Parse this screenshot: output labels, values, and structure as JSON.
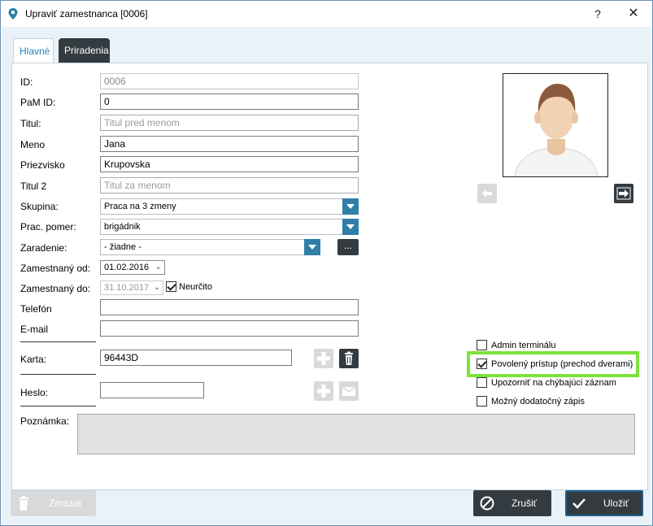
{
  "window": {
    "title": "Upraviť zamestnanca [0006]",
    "help_label": "?",
    "close_label": "✕"
  },
  "tabs": [
    {
      "label": "Hlavné",
      "active": true
    },
    {
      "label": "Priradenia",
      "active": false
    }
  ],
  "form": {
    "id": {
      "label": "ID:",
      "value": "0006"
    },
    "pam_id": {
      "label": "PaM ID:",
      "value": "0"
    },
    "titul": {
      "label": "Titul:",
      "placeholder": "Titul pred menom"
    },
    "meno": {
      "label": "Meno",
      "value": "Jana"
    },
    "priezvisko": {
      "label": "Priezvisko",
      "value": "Krupovska"
    },
    "titul2": {
      "label": "Titul 2",
      "placeholder": "Titul za menom"
    },
    "skupina": {
      "label": "Skupina:",
      "value": "Praca na 3 zmeny"
    },
    "prac_pomer": {
      "label": "Prac. pomer:",
      "value": "brigádnik"
    },
    "zaradenie": {
      "label": "Zaradenie:",
      "value": "- žiadne -",
      "more_label": "..."
    },
    "zamestnany_od": {
      "label": "Zamestnaný od:",
      "value": "01.02.2016"
    },
    "zamestnany_do": {
      "label": "Zamestnaný do:",
      "value": "31.10.2017",
      "neurcito_label": "Neurčito",
      "neurcito_checked": true
    },
    "telefon": {
      "label": "Telefón",
      "value": ""
    },
    "email": {
      "label": "E-mail",
      "value": ""
    },
    "karta": {
      "label": "Karta:",
      "value": "96443D"
    },
    "heslo": {
      "label": "Heslo:",
      "value": ""
    },
    "poznamka": {
      "label": "Poznámka:",
      "value": ""
    }
  },
  "options": [
    {
      "label": "Admin terminálu",
      "checked": false
    },
    {
      "label": "Povolený prístup (prechod dverami)",
      "checked": true
    },
    {
      "label": "Upozorniť na chýbajúci záznam",
      "checked": false
    },
    {
      "label": "Možný dodatočný zápis",
      "checked": false
    }
  ],
  "footer": {
    "delete_label": "Zmazať",
    "cancel_label": "Zrušiť",
    "save_label": "Uložiť"
  },
  "colors": {
    "accent": "#2f7fa8",
    "dark_button": "#333b40",
    "highlight": "#7be33a",
    "tab_active_text": "#2a7fc0"
  },
  "icons": {
    "app": "location-pin-icon",
    "photo_prev": "arrow-left-icon",
    "photo_next": "arrow-right-icon",
    "add": "plus-icon",
    "trash": "trash-icon",
    "mail": "envelope-icon",
    "cancel": "cancel-icon",
    "save": "checkmark-icon"
  }
}
